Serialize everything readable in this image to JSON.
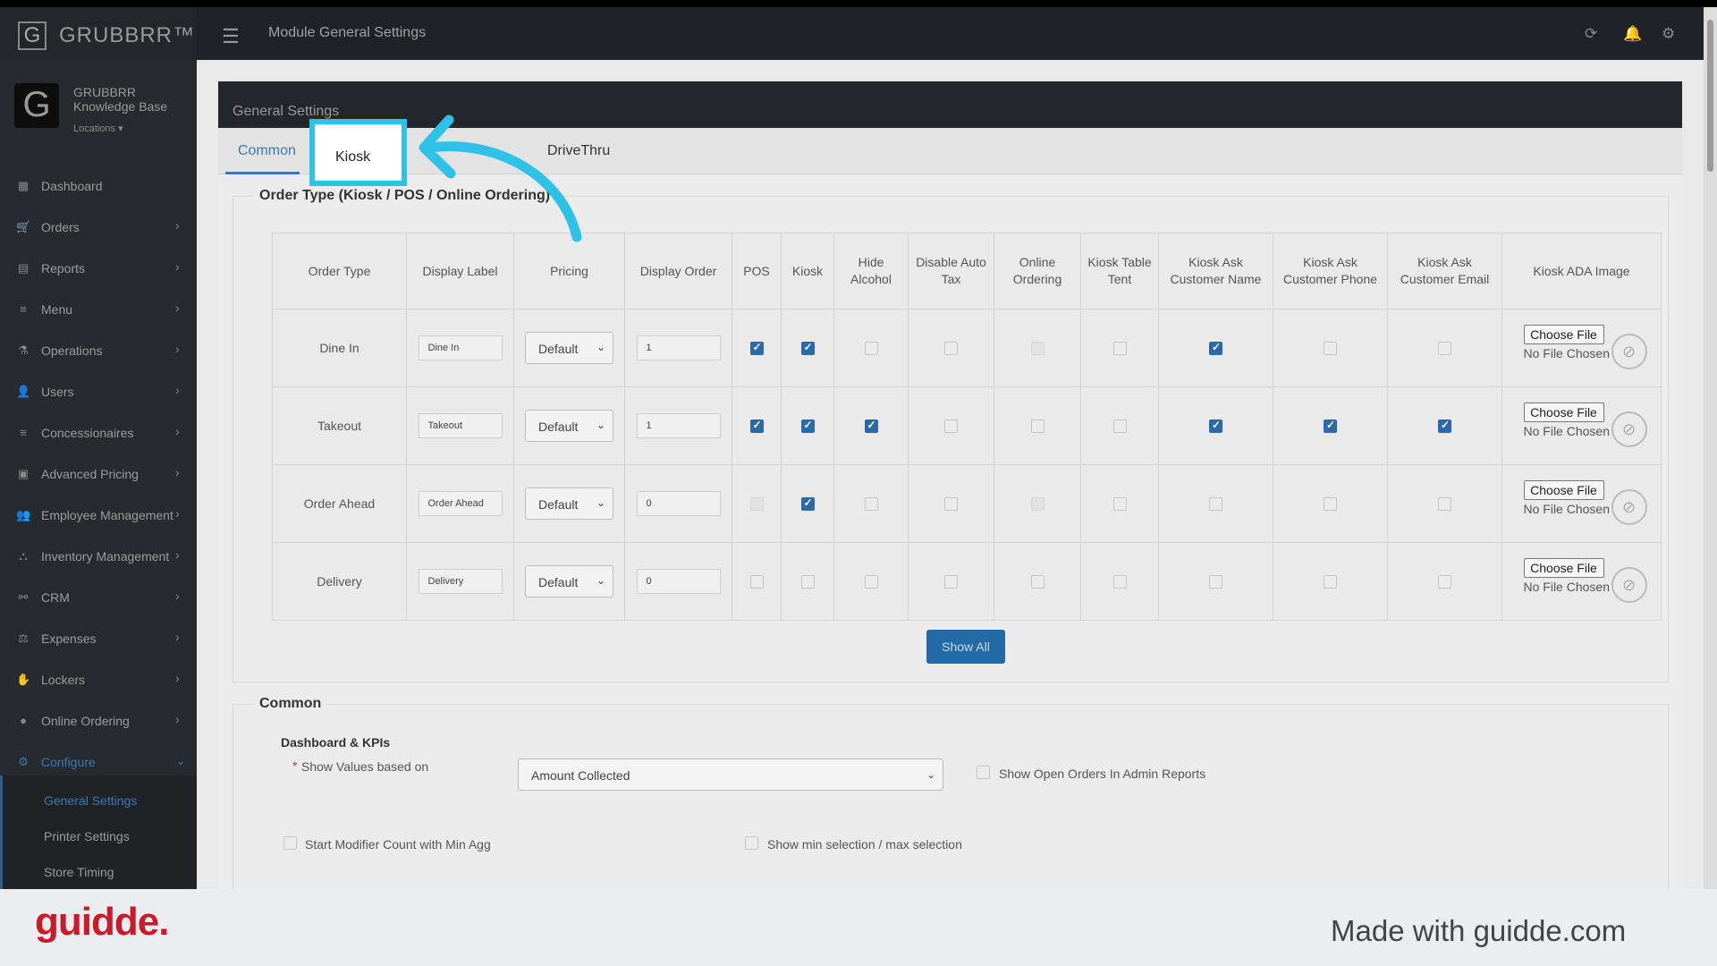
{
  "app": {
    "brand": "GRUBBRR™",
    "page_title": "Module General Settings"
  },
  "org": {
    "name": "GRUBBRR Knowledge Base",
    "locations_label": "Locations ▾"
  },
  "sidebar": {
    "items": [
      {
        "label": "Dashboard",
        "icon": "dashboard-icon",
        "glyph": "▦",
        "chev": ""
      },
      {
        "label": "Orders",
        "icon": "cart-icon",
        "glyph": "🛒",
        "chev": "›"
      },
      {
        "label": "Reports",
        "icon": "report-icon",
        "glyph": "▤",
        "chev": "›"
      },
      {
        "label": "Menu",
        "icon": "menu-icon",
        "glyph": "≡",
        "chev": "›"
      },
      {
        "label": "Operations",
        "icon": "flask-icon",
        "glyph": "⚗",
        "chev": "›"
      },
      {
        "label": "Users",
        "icon": "users-icon",
        "glyph": "👤",
        "chev": "›"
      },
      {
        "label": "Concessionaires",
        "icon": "list-icon",
        "glyph": "≡",
        "chev": "›"
      },
      {
        "label": "Advanced Pricing",
        "icon": "money-icon",
        "glyph": "▣",
        "chev": "›"
      },
      {
        "label": "Employee Management",
        "icon": "group-icon",
        "glyph": "👥",
        "chev": "›"
      },
      {
        "label": "Inventory Management",
        "icon": "sitemap-icon",
        "glyph": "⛬",
        "chev": "›"
      },
      {
        "label": "CRM",
        "icon": "link-icon",
        "glyph": "⚯",
        "chev": "›"
      },
      {
        "label": "Expenses",
        "icon": "scale-icon",
        "glyph": "⚖",
        "chev": "›"
      },
      {
        "label": "Lockers",
        "icon": "locker-icon",
        "glyph": "✋",
        "chev": "›"
      },
      {
        "label": "Online Ordering",
        "icon": "globe-icon",
        "glyph": "●",
        "chev": "›"
      },
      {
        "label": "Configure",
        "icon": "gear-icon",
        "glyph": "⚙",
        "chev": "⌄"
      }
    ],
    "submenu": [
      "General Settings",
      "Printer Settings",
      "Store Timing"
    ]
  },
  "panel": {
    "title": "General Settings"
  },
  "tabs": {
    "common": "Common",
    "kiosk": "Kiosk",
    "drivethru": "DriveThru"
  },
  "order_type": {
    "legend": "Order Type (Kiosk / POS / Online Ordering)",
    "headers": [
      "Order Type",
      "Display Label",
      "Pricing",
      "Display Order",
      "POS",
      "Kiosk",
      "Hide Alcohol",
      "Disable Auto Tax",
      "Online Ordering",
      "Kiosk Table Tent",
      "Kiosk Ask Customer Name",
      "Kiosk Ask Customer Phone",
      "Kiosk Ask Customer Email",
      "Kiosk ADA Image"
    ],
    "rows": [
      {
        "type": "Dine In",
        "label": "Dine In",
        "pricing": "Default",
        "order": "1",
        "checks": [
          "on",
          "on",
          "off",
          "off",
          "dis",
          "off",
          "on",
          "off",
          "off"
        ]
      },
      {
        "type": "Takeout",
        "label": "Takeout",
        "pricing": "Default",
        "order": "1",
        "checks": [
          "on",
          "on",
          "on",
          "off",
          "off",
          "off",
          "on",
          "on",
          "on"
        ]
      },
      {
        "type": "Order Ahead",
        "label": "Order Ahead",
        "pricing": "Default",
        "order": "0",
        "checks": [
          "dis",
          "on",
          "off",
          "off",
          "dis",
          "off",
          "off",
          "off",
          "off"
        ]
      },
      {
        "type": "Delivery",
        "label": "Delivery",
        "pricing": "Default",
        "order": "0",
        "checks": [
          "off",
          "off",
          "off",
          "off",
          "off",
          "off",
          "off",
          "off",
          "off"
        ]
      }
    ],
    "choose_file": "Choose File",
    "no_file": "No File Chosen",
    "show_all": "Show All"
  },
  "common": {
    "legend": "Common",
    "dashboard_kpis": "Dashboard & KPIs",
    "required_mark": "*",
    "show_values_label": "Show Values based on",
    "show_values_value": "Amount Collected",
    "open_orders_label": "Show Open Orders In Admin Reports",
    "modifier_count_label": "Start Modifier Count with Min Agg",
    "min_max_label": "Show min selection / max selection"
  },
  "footer": {
    "logo": "guidde.",
    "made_with": "Made with guidde.com"
  },
  "colors": {
    "accent": "#3a79b6",
    "highlight": "#2ec2e6",
    "guidde_red": "#c91b2c"
  }
}
